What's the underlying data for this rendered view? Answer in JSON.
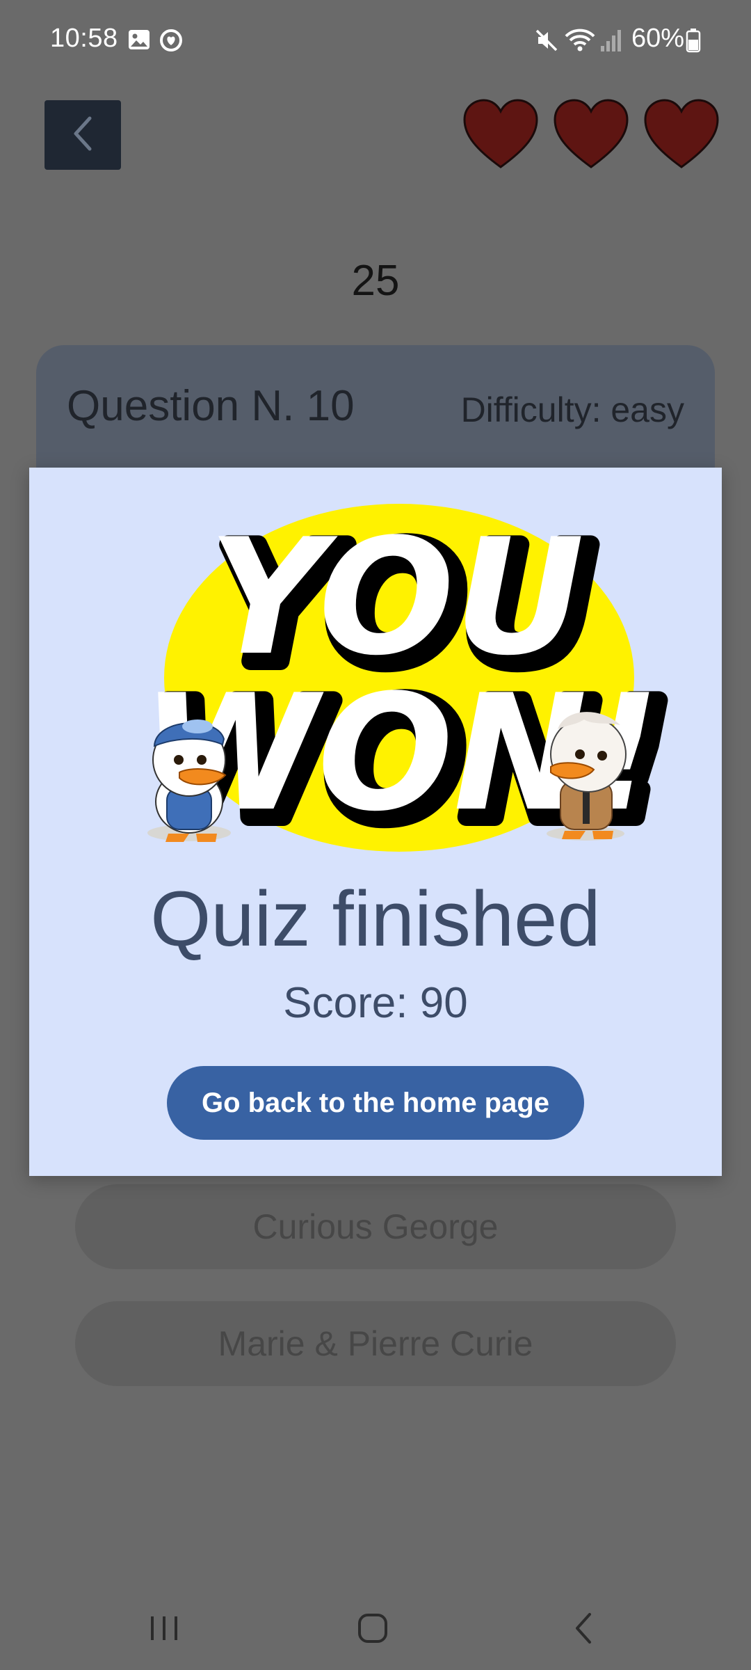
{
  "status_bar": {
    "time": "10:58",
    "battery_text": "60%",
    "icons": [
      "gallery-icon",
      "heart-circle-icon",
      "mute-icon",
      "wifi-icon",
      "signal-icon",
      "battery-icon"
    ]
  },
  "header": {
    "back_icon": "chevron-left-icon",
    "lives": 3,
    "heart_color": "#5e1512"
  },
  "timer": "25",
  "question": {
    "number_label": "Question N. 10",
    "difficulty_label": "Difficulty: easy"
  },
  "answers": [
    "Curious George",
    "Marie & Pierre Curie"
  ],
  "modal": {
    "banner_text": [
      "YOU",
      "WON!"
    ],
    "title": "Quiz finished",
    "score": "Score: 90",
    "home_button": "Go back to the home page"
  },
  "colors": {
    "modal_bg": "#d7e2fc",
    "button_bg": "#3862a3",
    "title_text": "#3d4c68",
    "banner_yellow": "#fff200"
  },
  "nav_bar": {
    "icons": [
      "recent-apps-icon",
      "home-icon",
      "back-icon"
    ]
  }
}
